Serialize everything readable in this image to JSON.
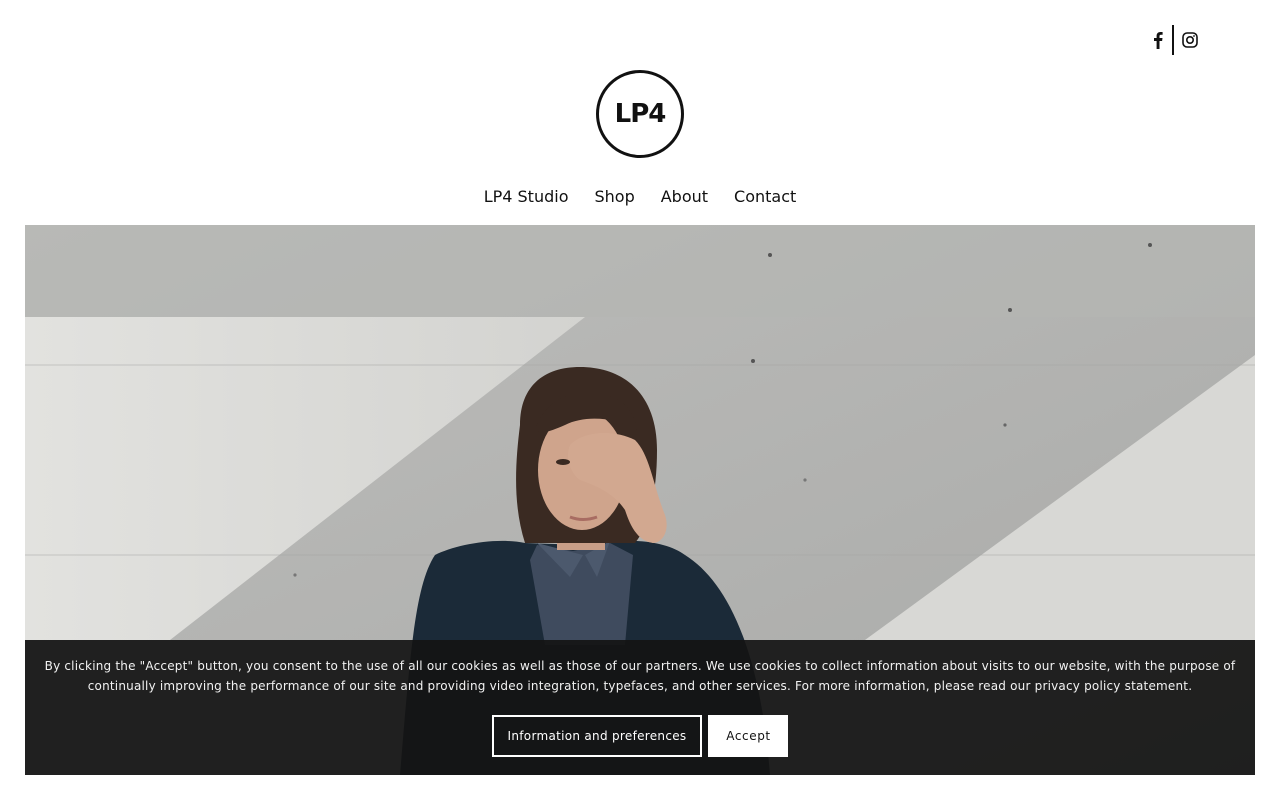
{
  "header": {
    "social": [
      {
        "icon": "facebook-icon",
        "label": "f"
      },
      {
        "icon": "instagram-icon"
      }
    ],
    "logo_text": "LP4"
  },
  "nav": {
    "items": [
      "LP4 Studio",
      "Shop",
      "About",
      "Contact"
    ]
  },
  "colors": {
    "text": "#111111",
    "banner_bg": "#141414",
    "wall": "#c9c9c7"
  },
  "cookie_banner": {
    "text": "By clicking the \"Accept\" button, you consent to the use of all our cookies as well as those of our partners. We use cookies to collect information about visits to our website, with the purpose of continually improving the performance of our site and providing video integration, typefaces, and other services. For more information, please read our privacy policy statement.",
    "info_button": "Information and preferences",
    "accept_button": "Accept"
  }
}
